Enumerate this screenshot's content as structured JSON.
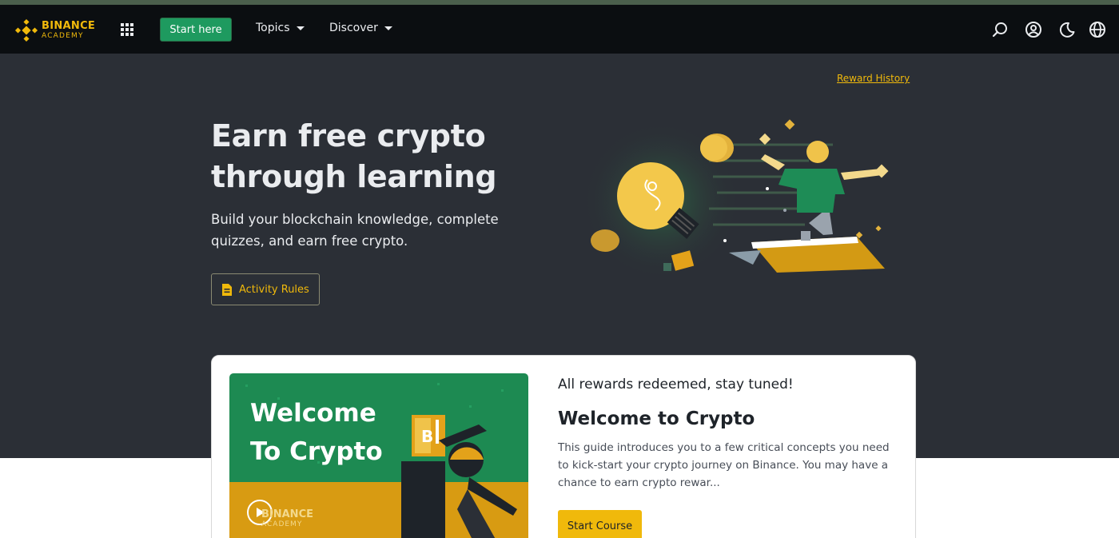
{
  "brand": {
    "line1": "BINANCE",
    "line2": "ACADEMY",
    "icon": "binance-logo-icon",
    "color": "#f0b90b"
  },
  "nav": {
    "apps_icon": "grid-apps-icon",
    "start_label": "Start here",
    "topics_label": "Topics",
    "discover_label": "Discover",
    "right_icons": [
      "search-icon",
      "user-icon",
      "moon-icon",
      "globe-icon"
    ]
  },
  "hero": {
    "reward_history": "Reward History",
    "title": "Earn free crypto through learning",
    "subtitle": "Build your blockchain knowledge, complete quizzes, and earn free crypto.",
    "rules_label": "Activity Rules",
    "rules_icon": "document-icon"
  },
  "course": {
    "thumb_line1": "Welcome",
    "thumb_line2": "To Crypto",
    "thumb_brand1": "BINANCE",
    "thumb_brand2": "ACADEMY",
    "status": "All rewards redeemed, stay tuned!",
    "title": "Welcome to Crypto",
    "description": "This guide introduces you to a few critical concepts you need to kick-start your crypto journey on Binance. You may have a chance to earn crypto rewar...",
    "cta_label": "Start Course"
  },
  "colors": {
    "accent": "#f0b90b",
    "green": "#1e9a5f",
    "navbar": "#0b0e11",
    "hero_bg": "#2b2f36"
  }
}
